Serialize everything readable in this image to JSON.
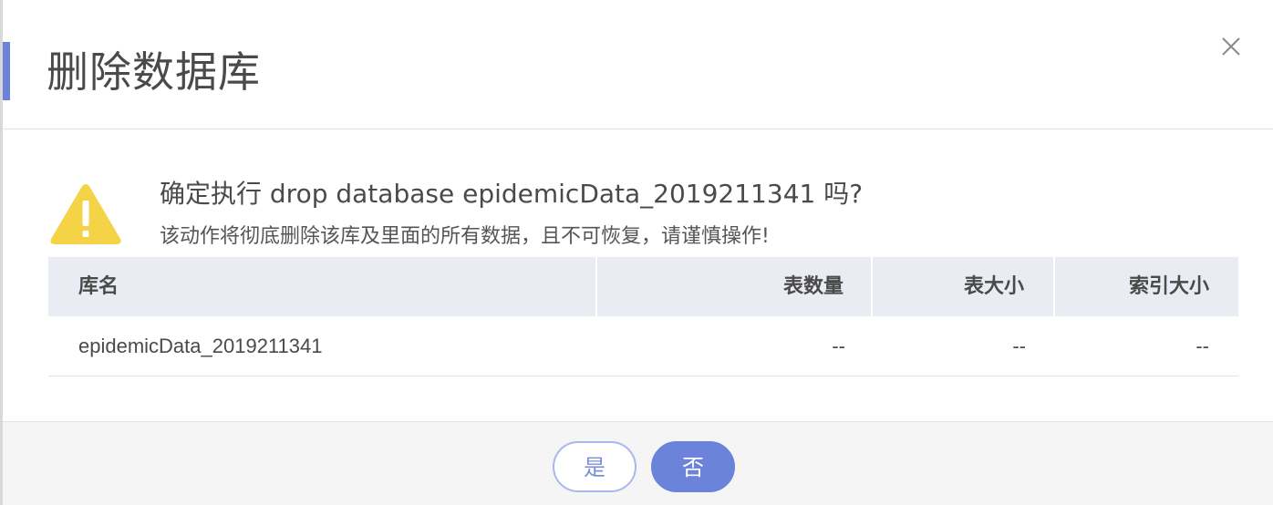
{
  "dialog": {
    "title": "删除数据库",
    "question": "确定执行 drop database epidemicData_2019211341 吗?",
    "warning": "该动作将彻底删除该库及里面的所有数据，且不可恢复，请谨慎操作!",
    "close_icon": "close-icon",
    "warning_icon": "warning-triangle-icon",
    "accent_color": "#6b84d9",
    "warning_color": "#f5d346"
  },
  "table": {
    "columns": [
      "库名",
      "表数量",
      "表大小",
      "索引大小"
    ],
    "rows": [
      [
        "epidemicData_2019211341",
        "--",
        "--",
        "--"
      ]
    ]
  },
  "footer": {
    "yes_label": "是",
    "no_label": "否"
  }
}
